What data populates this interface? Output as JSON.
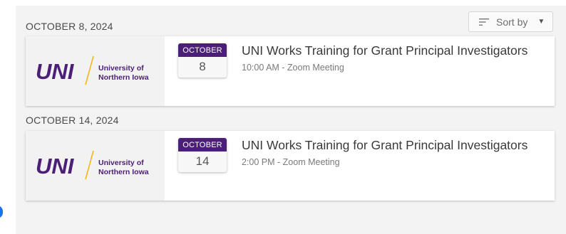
{
  "sort": {
    "label": "Sort by"
  },
  "logo": {
    "mark": "UNI",
    "line1": "University of",
    "line2": "Northern Iowa",
    "color_purple": "#4b1f77",
    "color_gold": "#f2b619"
  },
  "events": [
    {
      "date_heading": "OCTOBER 8, 2024",
      "month": "OCTOBER",
      "day": "8",
      "title": "UNI Works Training for Grant Principal Investigators",
      "meta": "10:00 AM  - Zoom Meeting"
    },
    {
      "date_heading": "OCTOBER 14, 2024",
      "month": "OCTOBER",
      "day": "14",
      "title": "UNI Works Training for Grant Principal Investigators",
      "meta": "2:00 PM  - Zoom Meeting"
    }
  ]
}
